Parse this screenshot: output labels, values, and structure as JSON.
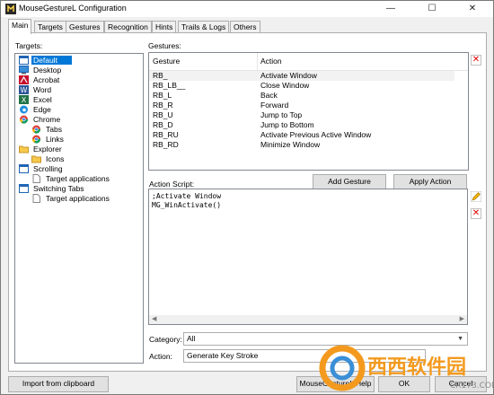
{
  "window": {
    "title": "MouseGestureL Configuration",
    "minimize": "—",
    "maximize": "☐",
    "close": "✕"
  },
  "tabs": [
    "Main",
    "Targets",
    "Gestures",
    "Recognition",
    "Hints",
    "Trails & Logs",
    "Others"
  ],
  "targets": {
    "label": "Targets:",
    "items": [
      {
        "label": "Default",
        "icon": "window-icon",
        "selected": true
      },
      {
        "label": "Desktop",
        "icon": "desktop-icon"
      },
      {
        "label": "Acrobat",
        "icon": "acrobat-icon"
      },
      {
        "label": "Word",
        "icon": "word-icon"
      },
      {
        "label": "Excel",
        "icon": "excel-icon"
      },
      {
        "label": "Edge",
        "icon": "edge-icon"
      },
      {
        "label": "Chrome",
        "icon": "chrome-icon"
      },
      {
        "label": "Tabs",
        "icon": "chrome-icon"
      },
      {
        "label": "Links",
        "icon": "chrome-icon"
      },
      {
        "label": "Explorer",
        "icon": "folder-icon"
      },
      {
        "label": "Icons",
        "icon": "folder-icon"
      },
      {
        "label": "Scrolling",
        "icon": "window-icon"
      },
      {
        "label": "Target applications",
        "icon": "document-icon"
      },
      {
        "label": "Switching Tabs",
        "icon": "window-icon"
      },
      {
        "label": "Target applications",
        "icon": "document-icon"
      }
    ]
  },
  "gestures": {
    "label": "Gestures:",
    "columns": [
      "Gesture",
      "Action"
    ],
    "rows": [
      [
        "RB_",
        "Activate Window"
      ],
      [
        "RB_LB__",
        "Close Window"
      ],
      [
        "RB_L",
        "Back"
      ],
      [
        "RB_R",
        "Forward"
      ],
      [
        "RB_U",
        "Jump to Top"
      ],
      [
        "RB_D",
        "Jump to Bottom"
      ],
      [
        "RB_RU",
        "Activate Previous Active Window"
      ],
      [
        "RB_RD",
        "Minimize Window"
      ]
    ]
  },
  "buttons": {
    "add_gesture": "Add Gesture",
    "apply_action": "Apply Action",
    "import": "Import from clipboard",
    "help": "MouseGestureL Help",
    "ok": "OK",
    "cancel": "Cancel"
  },
  "script": {
    "label": "Action Script:",
    "text": ";Activate Window\nMG_WinActivate()"
  },
  "category": {
    "label": "Category:",
    "value": "All"
  },
  "action": {
    "label": "Action:",
    "value": "Generate Key Stroke"
  },
  "watermark": {
    "text": "西西软件园",
    "sub": "CR173.COM"
  },
  "colors": {
    "selection": "#0078d7",
    "delete": "#dd0000",
    "watermark_orange": "#f39a1e",
    "watermark_blue": "#3a8fd6"
  }
}
